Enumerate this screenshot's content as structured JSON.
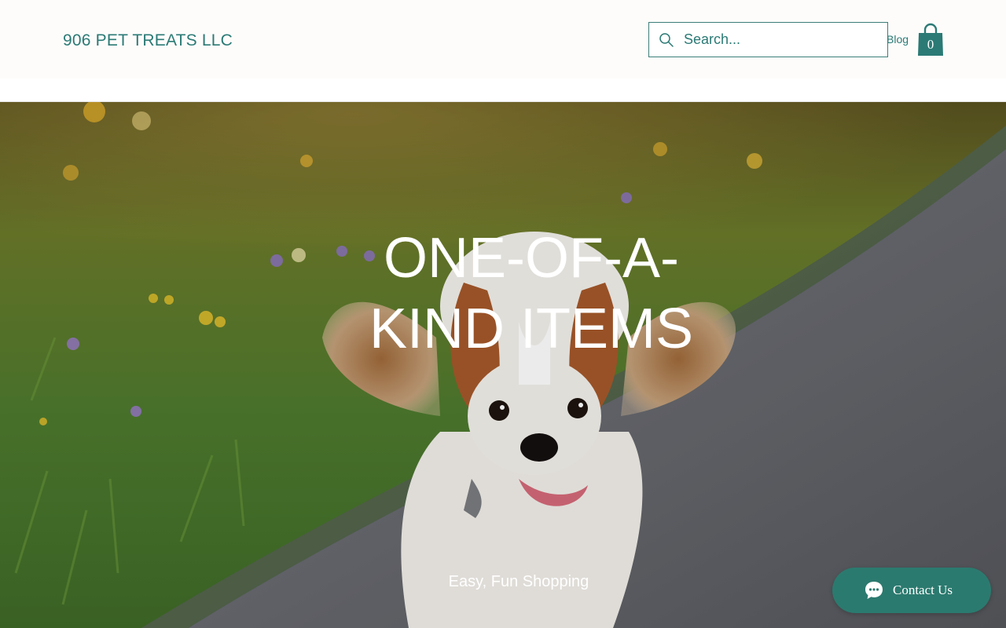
{
  "header": {
    "brand": "906 PET TREATS LLC",
    "search": {
      "placeholder": "Search..."
    },
    "nav": {
      "blog": "Blog"
    },
    "cart": {
      "count": "0"
    }
  },
  "hero": {
    "title_line1": "ONE-OF-A-",
    "title_line2": "KIND ITEMS",
    "subtitle": "Easy, Fun Shopping"
  },
  "chat": {
    "label": "Contact Us"
  },
  "icons": {
    "search": "search-icon",
    "cart": "shopping-bag-icon",
    "chat": "chat-bubble-icon"
  },
  "colors": {
    "accent": "#2b7a75",
    "chat_button": "#2b7a6f",
    "header_bg": "#fdfcfb"
  }
}
